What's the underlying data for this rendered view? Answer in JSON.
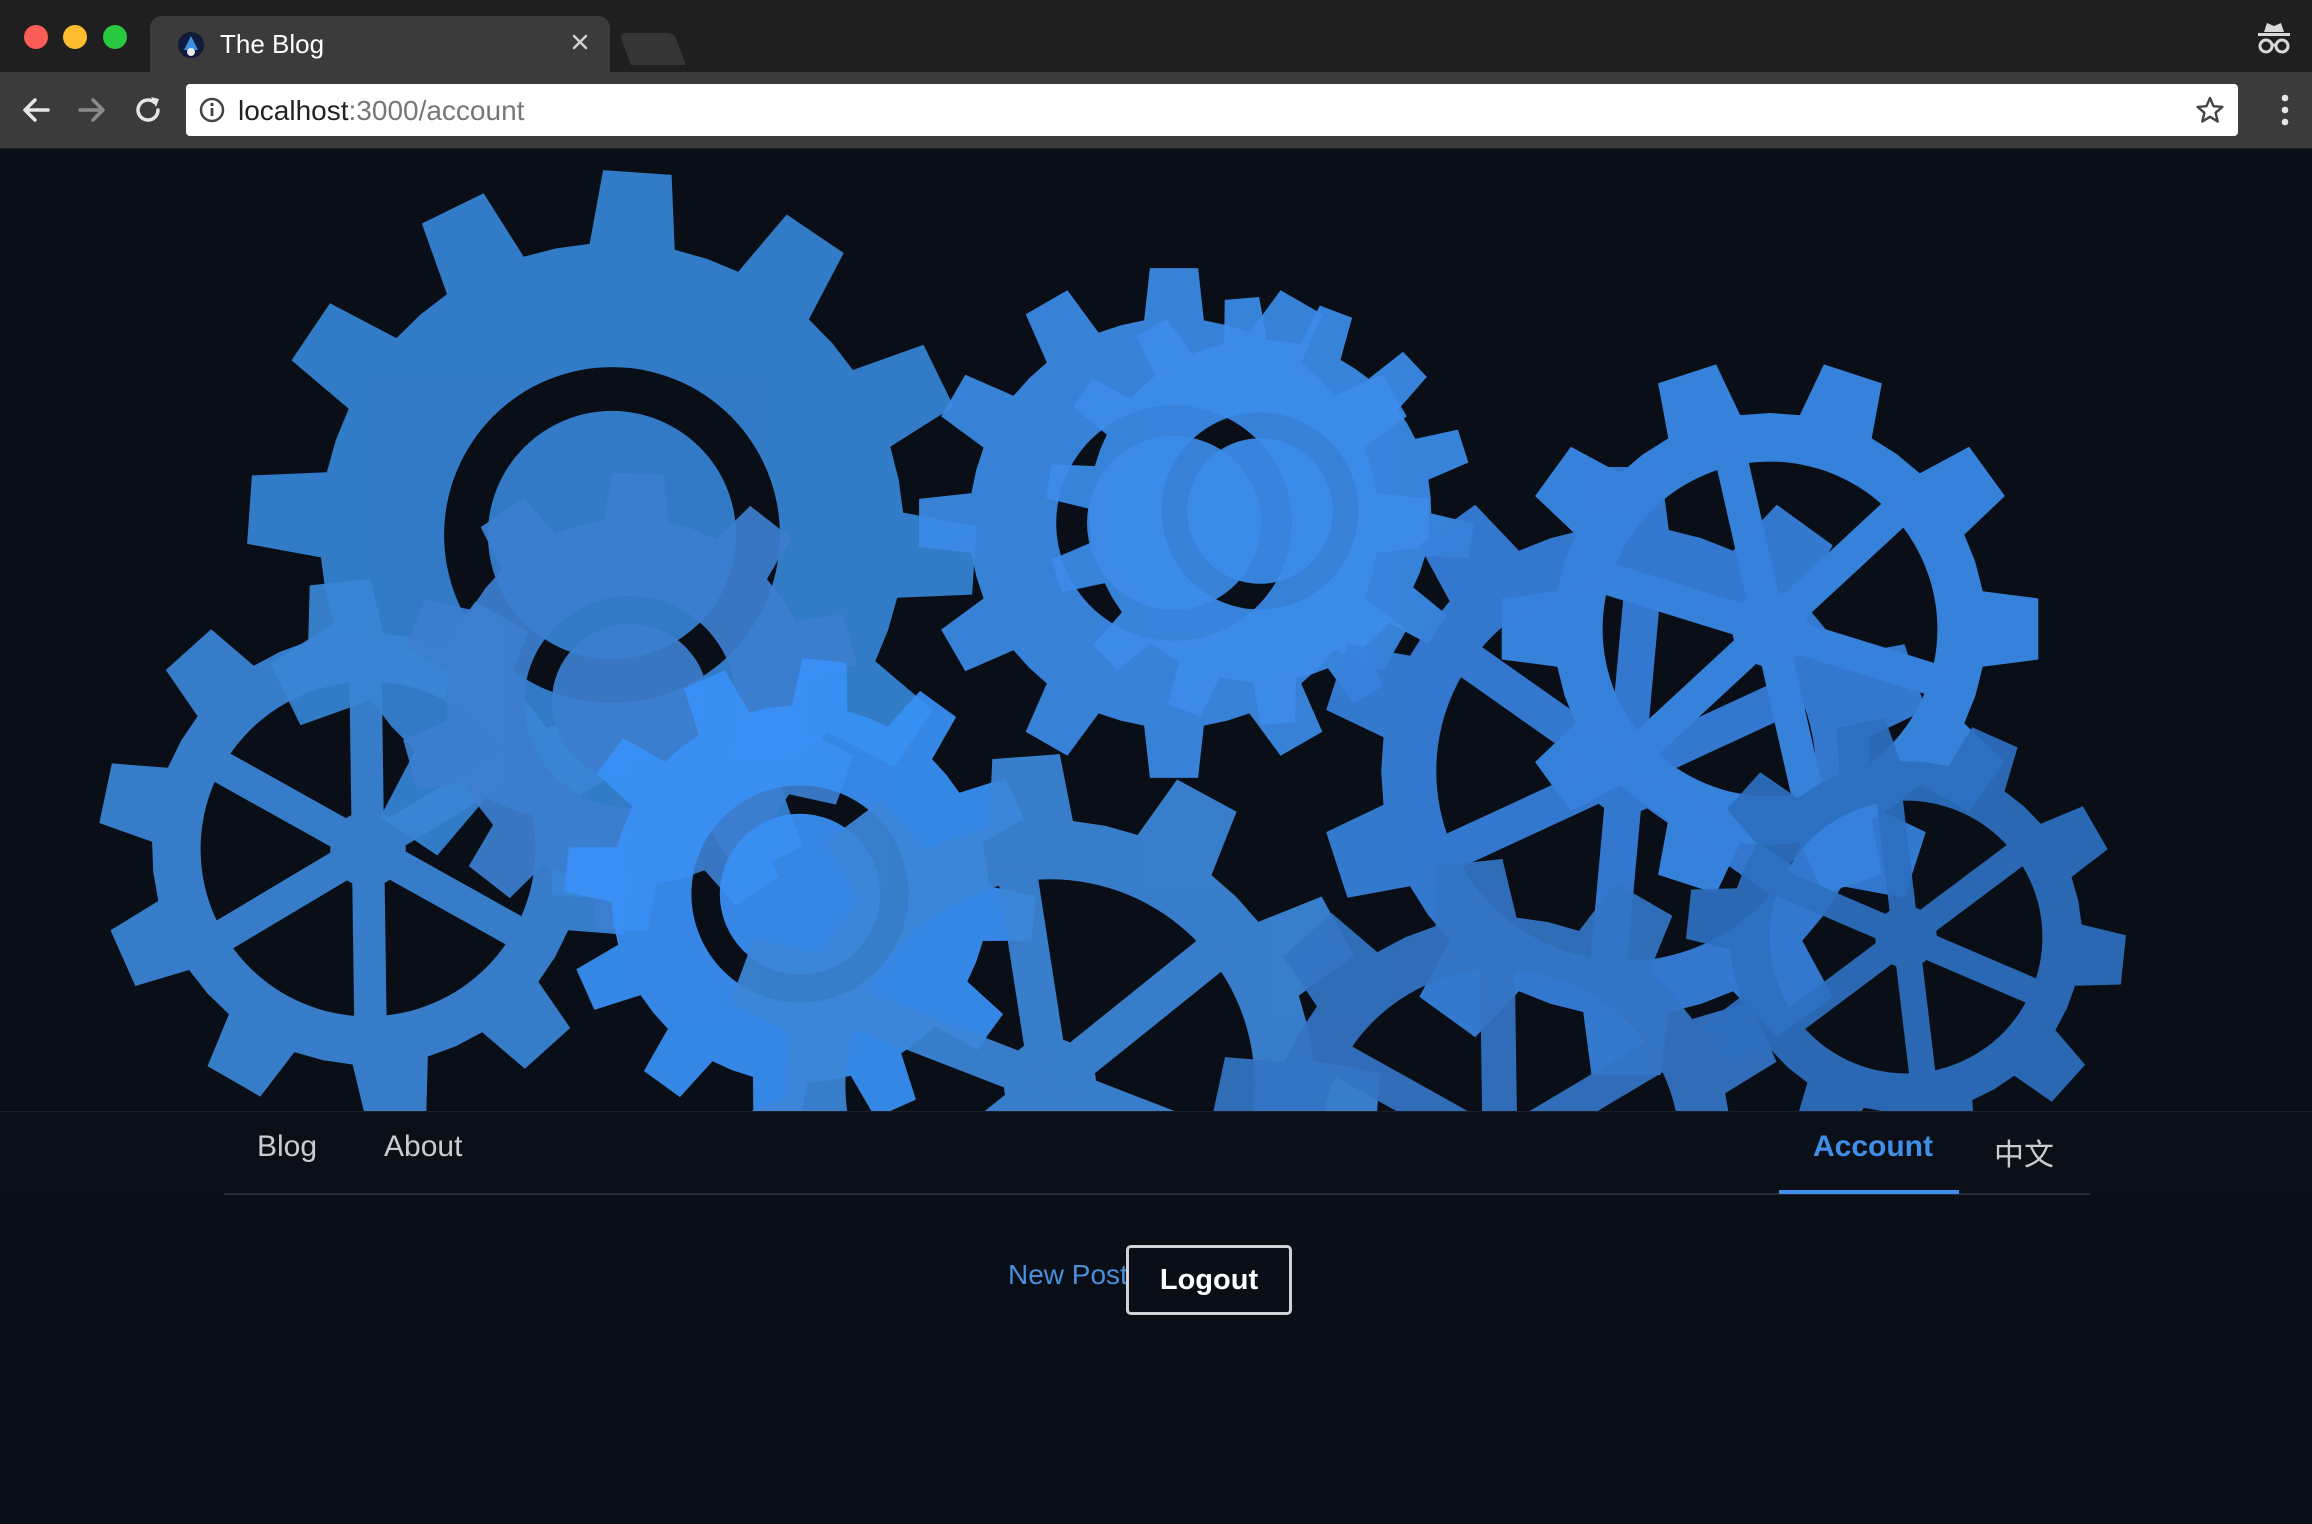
{
  "browser": {
    "tab_title": "The Blog",
    "url_host": "localhost",
    "url_path": ":3000/account"
  },
  "nav": {
    "left": [
      {
        "label": "Blog"
      },
      {
        "label": "About"
      }
    ],
    "right": [
      {
        "label": "Account",
        "active": true
      },
      {
        "label": "中文"
      }
    ]
  },
  "actions": {
    "new_post": "New Post",
    "logout": "Logout"
  },
  "colors": {
    "page_bg": "#0a0e16",
    "accent": "#3f8fe8",
    "gear_blue": "#3a8ae0"
  },
  "icons": [
    "favicon-icon",
    "tab-close-icon",
    "incognito-icon",
    "back-arrow-icon",
    "forward-arrow-icon",
    "reload-icon",
    "site-info-icon",
    "bookmark-star-icon",
    "browser-menu-icon",
    "gear-icon"
  ]
}
